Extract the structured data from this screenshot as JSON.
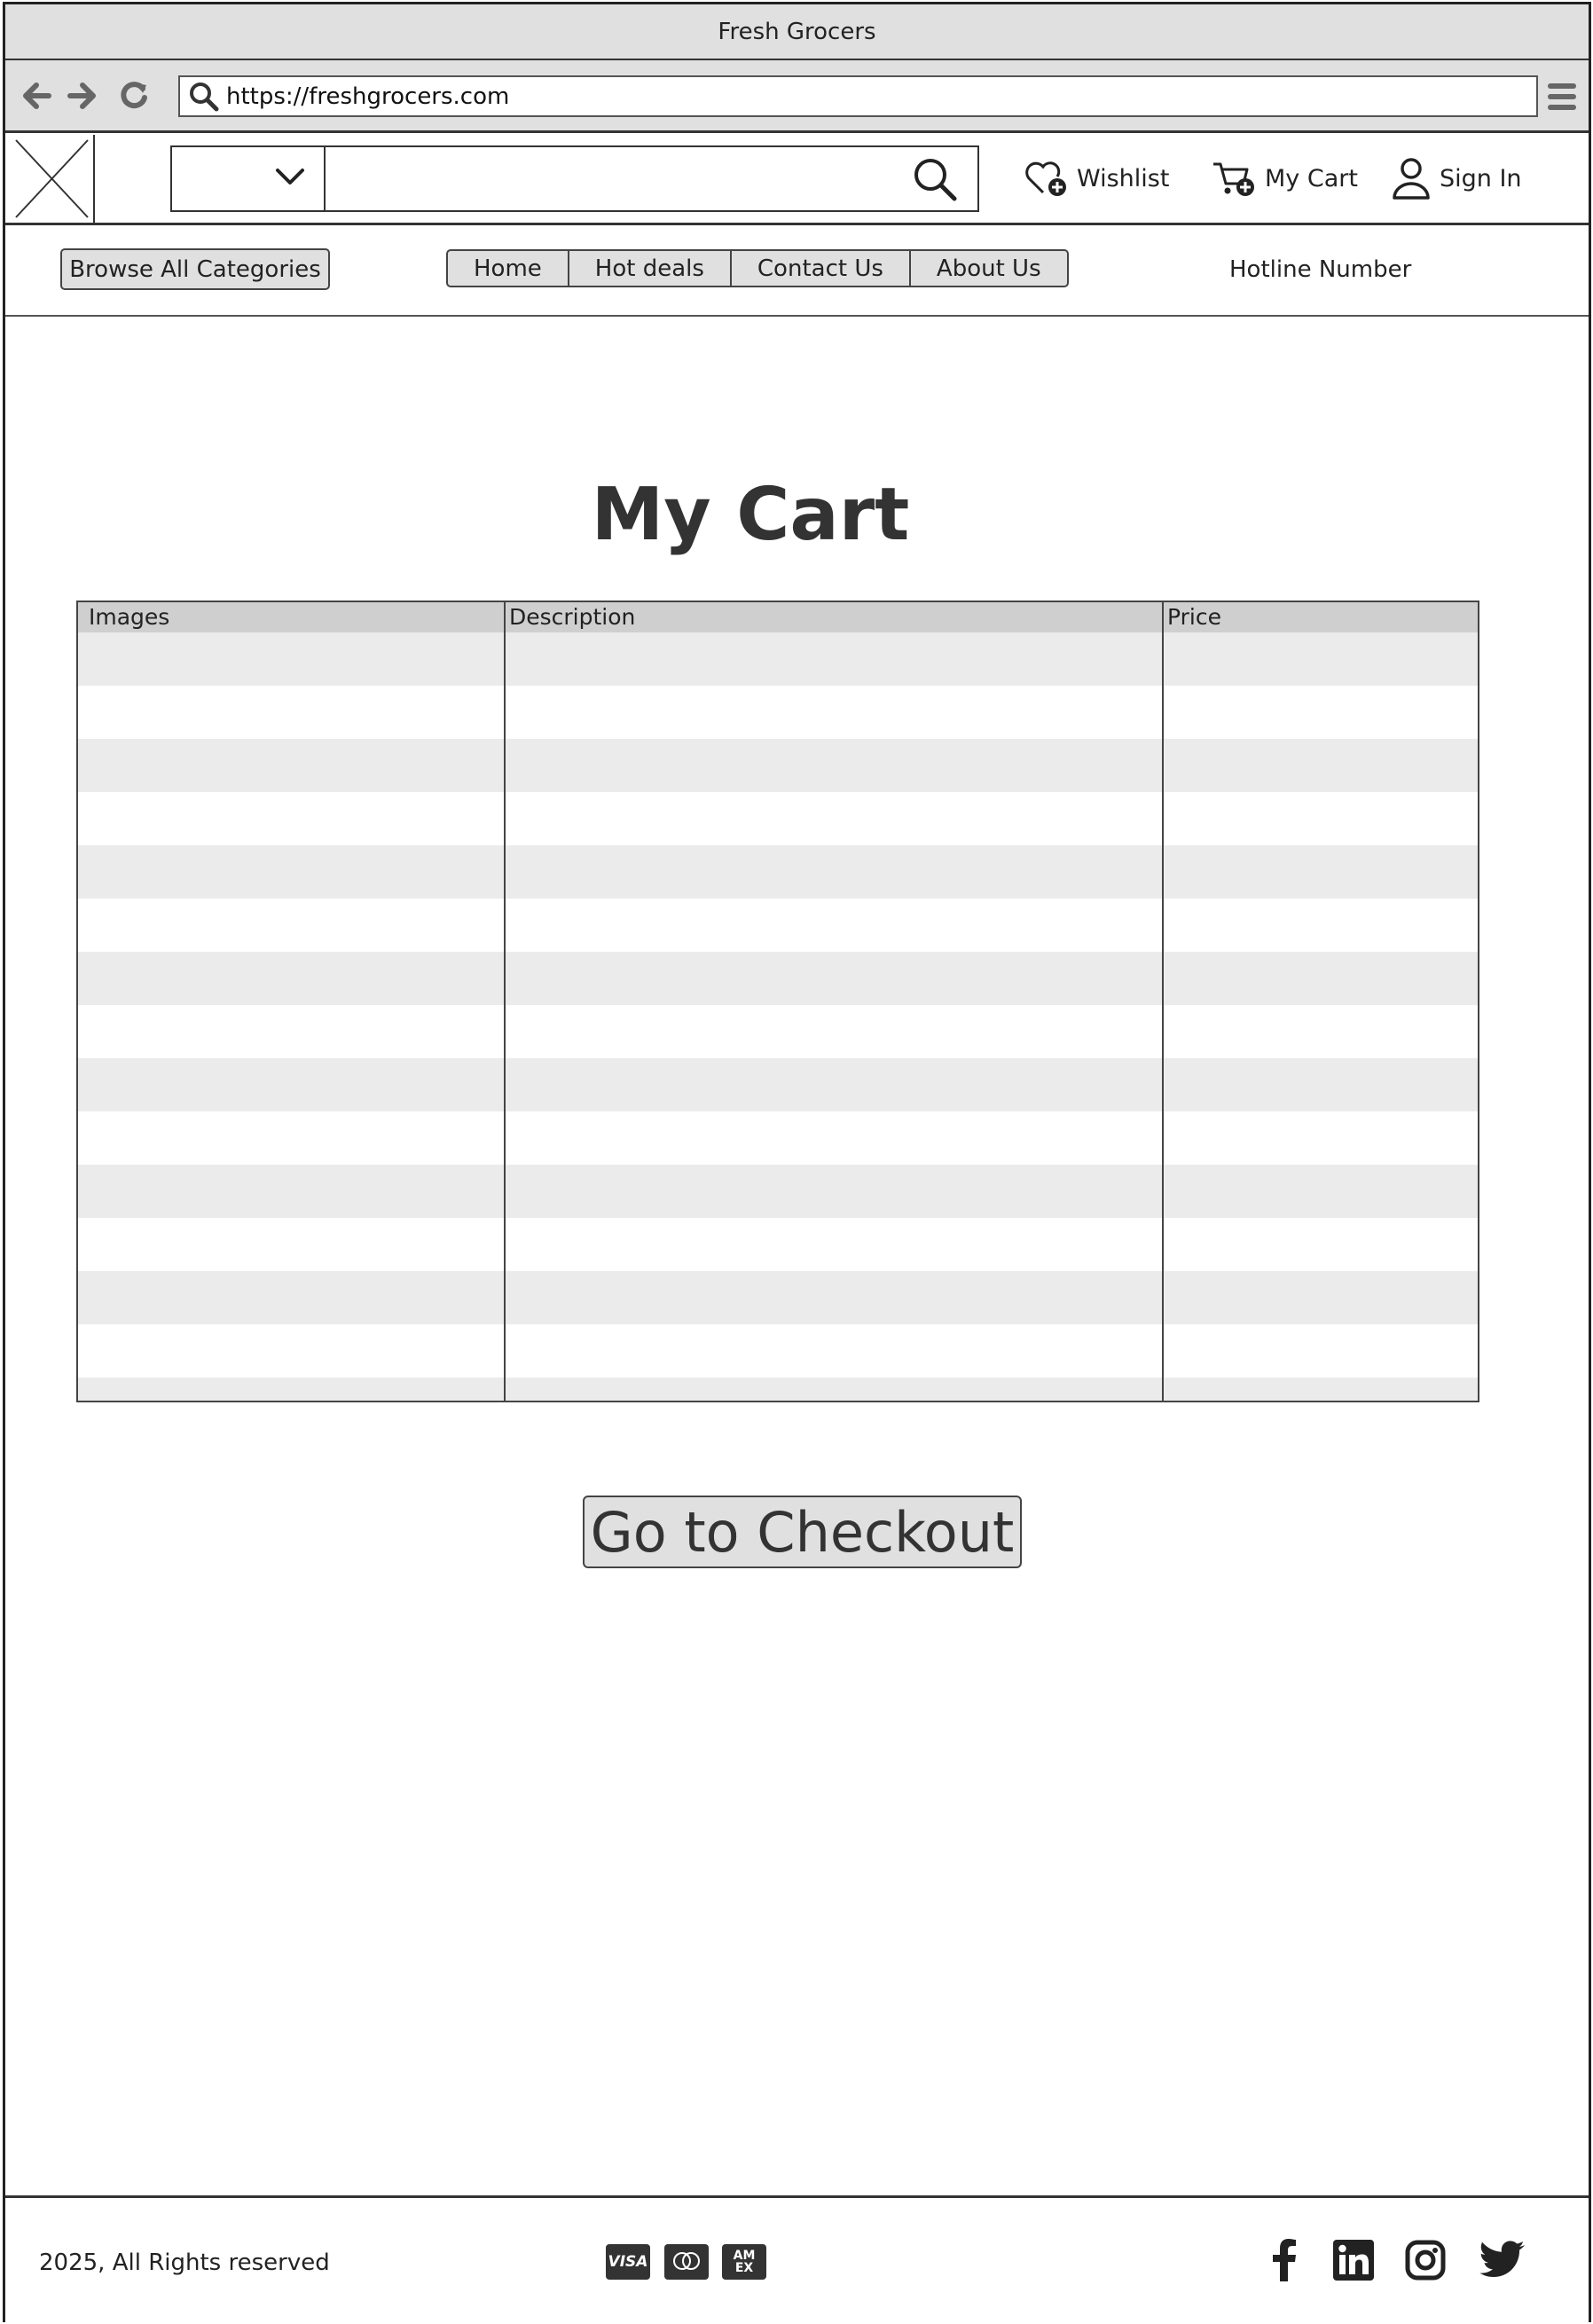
{
  "window": {
    "title": "Fresh Grocers"
  },
  "browser": {
    "url": "https://freshgrocers.com",
    "icons": [
      "back-arrow-icon",
      "forward-arrow-icon",
      "reload-icon",
      "search-icon",
      "menu-icon"
    ]
  },
  "header": {
    "category_select_value": "",
    "search_placeholder": "",
    "actions": {
      "wishlist": "Wishlist",
      "cart": "My Cart",
      "signin": "Sign In"
    }
  },
  "nav": {
    "browse_label": "Browse All Categories",
    "tabs": [
      "Home",
      "Hot deals",
      "Contact Us",
      "About Us"
    ],
    "hotline": "Hotline Number"
  },
  "main": {
    "title": "My Cart",
    "table": {
      "columns": [
        "Images",
        "Description",
        "Price"
      ],
      "row_count": 15
    },
    "checkout_label": "Go to Checkout"
  },
  "footer": {
    "copyright": "2025, All Rights reserved",
    "payment_icons": [
      "visa-icon",
      "mastercard-icon",
      "amex-icon"
    ],
    "payment_text": {
      "visa": "VISA",
      "amex": "AM\nEX"
    },
    "social_icons": [
      "facebook-icon",
      "linkedin-icon",
      "instagram-icon",
      "twitter-icon"
    ]
  }
}
